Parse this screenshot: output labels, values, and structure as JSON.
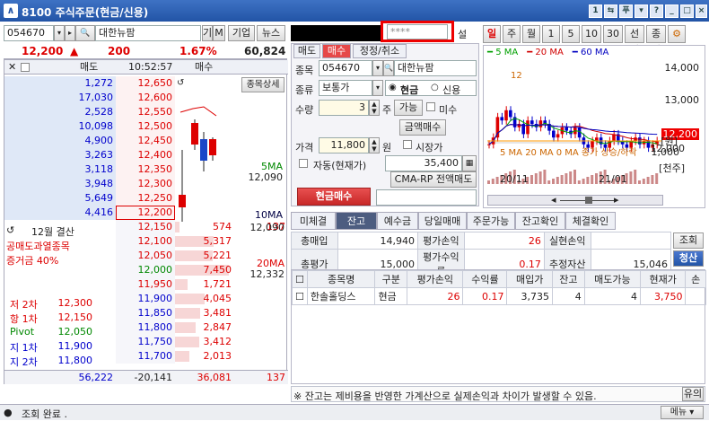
{
  "title_bar": {
    "title": "8100 주식주문(현금/신용)",
    "logo": "∧"
  },
  "stock_header": {
    "code": "054670",
    "name": "대한뉴팜",
    "btn_gi": "기",
    "btn_m": "M",
    "btn_company": "기업",
    "btn_news": "뉴스",
    "price": "12,200",
    "change_arrow": "▲",
    "change": "200",
    "rate": "1.67%",
    "volume": "60,824"
  },
  "orderbook": {
    "head_sell": "매도",
    "time": "10:52:57",
    "head_buy": "매수",
    "asks": [
      {
        "qty": "1,272",
        "price": "12,650"
      },
      {
        "qty": "17,030",
        "price": "12,600"
      },
      {
        "qty": "2,528",
        "price": "12,550"
      },
      {
        "qty": "10,098",
        "price": "12,500"
      },
      {
        "qty": "4,900",
        "price": "12,450"
      },
      {
        "qty": "3,263",
        "price": "12,400"
      },
      {
        "qty": "3,118",
        "price": "12,350"
      },
      {
        "qty": "3,948",
        "price": "12,300"
      },
      {
        "qty": "5,649",
        "price": "12,250"
      },
      {
        "qty": "4,416",
        "price": "12,200"
      }
    ],
    "bids": [
      {
        "price": "12,150",
        "qty": "574",
        "extra": "137"
      },
      {
        "price": "12,100",
        "qty": "5,317"
      },
      {
        "price": "12,050",
        "qty": "5,221"
      },
      {
        "price": "12,000",
        "qty": "7,450"
      },
      {
        "price": "11,950",
        "qty": "1,721"
      },
      {
        "price": "11,900",
        "qty": "4,045"
      },
      {
        "price": "11,850",
        "qty": "3,481"
      },
      {
        "price": "11,800",
        "qty": "2,847"
      },
      {
        "price": "11,750",
        "qty": "3,412"
      },
      {
        "price": "11,700",
        "qty": "2,013"
      }
    ],
    "btn_sangse": "종목상세",
    "ma5_label": "5MA",
    "ma5_val": "12,090",
    "ma10_label": "10MA",
    "ma10_val": "12,090",
    "ma20_label": "20MA",
    "ma20_val": "12,332",
    "settle_label": "12월 결산",
    "notice1": "공매도과열종목",
    "notice2": "증거금 40%",
    "stats": [
      {
        "label": "저 2차",
        "value": "12,300"
      },
      {
        "label": "항 1차",
        "value": "12,150"
      },
      {
        "label": "Pivot",
        "value": "12,050"
      },
      {
        "label": "지 1차",
        "value": "11,900"
      },
      {
        "label": "지 2차",
        "value": "11,800"
      }
    ],
    "total_ask": "56,222",
    "total_diff": "-20,141",
    "total_bid": "36,081",
    "total_extra": "137"
  },
  "order": {
    "account_masked": "",
    "password": "****",
    "set_label": "설",
    "tabs": [
      "매도",
      "매수",
      "정정/취소"
    ],
    "code_label": "종목",
    "code": "054670",
    "name": "대한뉴팜",
    "kind_label": "종류",
    "kind": "보통가",
    "radio_cash": "현금",
    "radio_credit": "신용",
    "qty_label": "수량",
    "qty": "3",
    "qty_unit": "주",
    "avail_btn": "가능",
    "miso_label": "미수",
    "amount_btn": "금액매수",
    "price_label": "가격",
    "price": "11,800",
    "price_unit": "원",
    "market_label": "시장가",
    "auto_label": "자동(현재가)",
    "total": "35,400",
    "cmarp_btn": "CMA-RP 전액매도",
    "submit_btn": "현금매수"
  },
  "chart": {
    "tabs": [
      "일",
      "주",
      "월",
      "1",
      "5",
      "10",
      "30",
      "선일",
      "종일"
    ],
    "legend": [
      {
        "name": "5 MA",
        "color": "#00a000"
      },
      {
        "name": "20 MA",
        "color": "#d00000"
      },
      {
        "name": "60 MA",
        "color": "#0000c0"
      }
    ],
    "price_axis": [
      "14,000",
      "13,000",
      "12,000"
    ],
    "current_price": "12,200",
    "price_unit": "[원]",
    "volume_legend": "5 MA 20 MA 0 MA 종가 상승/하락",
    "volume_axis": "1,000",
    "volume_unit": "[천주]",
    "dates": [
      "20/11",
      "21/01"
    ],
    "marker": "12"
  },
  "balance": {
    "tabs": [
      "미체결",
      "잔고",
      "예수금",
      "당일매매",
      "주문가능",
      "잔고확인",
      "체결확인"
    ],
    "summary": [
      [
        "총매입",
        "14,940",
        "평가손익",
        "26",
        "실현손익",
        ""
      ],
      [
        "총평가",
        "15,000",
        "평가수익률",
        "0.17",
        "추정자산",
        "15,046"
      ]
    ],
    "btn_inquire": "조회",
    "btn_settle": "청산",
    "columns": [
      "종목명",
      "구분",
      "평가손익",
      "수익률",
      "매입가",
      "잔고",
      "매도가능",
      "현재가",
      "손"
    ],
    "rows": [
      [
        "한솔홀딩스",
        "현금",
        "26",
        "0.17",
        "3,735",
        "4",
        "4",
        "3,750"
      ]
    ],
    "notice": "※ 잔고는 제비용을 반영한 가계산으로 실제손익과 차이가 발생할 수 있음.",
    "notice_btn": "유의"
  },
  "status": {
    "text": "조회 완료 .",
    "menu": "메뉴"
  }
}
